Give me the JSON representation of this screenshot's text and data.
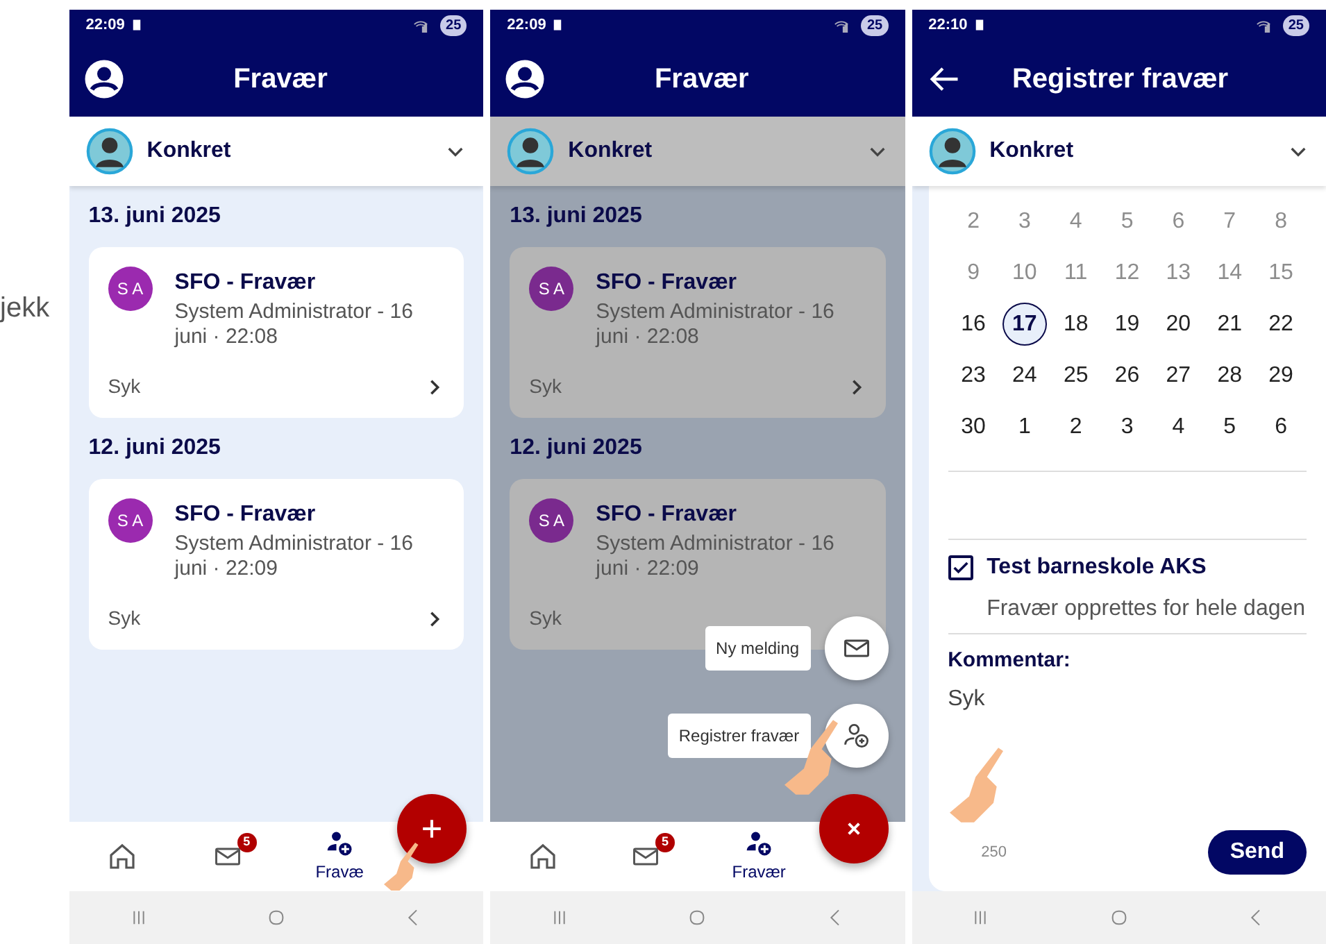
{
  "background_text": "jekk",
  "screens": [
    {
      "kind": "list",
      "dimmed": false,
      "status_bar": {
        "time": "22:09",
        "battery": "25"
      },
      "header": {
        "title": "Fravær"
      },
      "child_selector": {
        "name": "Konkret"
      },
      "days": [
        {
          "date": "13. juni 2025",
          "entries": [
            {
              "initials": "S A",
              "title": "SFO - Fravær",
              "meta": "System Administrator  - 16 juni · 22:08",
              "note": "Syk",
              "chevron_visible": true
            }
          ]
        },
        {
          "date": "12. juni 2025",
          "entries": [
            {
              "initials": "S A",
              "title": "SFO - Fravær",
              "meta": "System Administrator  - 16 juni · 22:09",
              "note": "Syk",
              "chevron_visible": true
            }
          ]
        }
      ],
      "bottom_nav": [
        {
          "selected": false
        },
        {
          "badge": "5",
          "selected": false
        },
        {
          "label": "Fravæ",
          "selected": true
        }
      ],
      "fab": {
        "kind": "add"
      }
    },
    {
      "kind": "list",
      "dimmed": true,
      "status_bar": {
        "time": "22:09",
        "battery": "25"
      },
      "header": {
        "title": "Fravær"
      },
      "child_selector": {
        "name": "Konkret"
      },
      "days": [
        {
          "date": "13. juni 2025",
          "entries": [
            {
              "initials": "S A",
              "title": "SFO - Fravær",
              "meta": "System Administrator  - 16 juni · 22:08",
              "note": "Syk",
              "chevron_visible": true
            }
          ]
        },
        {
          "date": "12. juni 2025",
          "entries": [
            {
              "initials": "S A",
              "title": "SFO - Fravær",
              "meta": "System Administrator  - 16 juni · 22:09",
              "note": "Syk",
              "chevron_visible": false
            }
          ]
        }
      ],
      "bottom_nav": [
        {
          "selected": false
        },
        {
          "badge": "5",
          "selected": false
        },
        {
          "label": "Fravær",
          "selected": true
        }
      ],
      "speed_dial": [
        {
          "label": "Ny melding"
        },
        {
          "label": "Registrer fravær"
        }
      ],
      "fab": {
        "kind": "close"
      }
    },
    {
      "kind": "form",
      "dimmed": false,
      "status_bar": {
        "time": "22:10",
        "battery": "25"
      },
      "header": {
        "title": "Registrer fravær"
      },
      "child_selector": {
        "name": "Konkret"
      },
      "calendar": [
        [
          {
            "day": "2",
            "muted": true,
            "selected": false
          },
          {
            "day": "3",
            "muted": true,
            "selected": false
          },
          {
            "day": "4",
            "muted": true,
            "selected": false
          },
          {
            "day": "5",
            "muted": true,
            "selected": false
          },
          {
            "day": "6",
            "muted": true,
            "selected": false
          },
          {
            "day": "7",
            "muted": true,
            "selected": false
          },
          {
            "day": "8",
            "muted": true,
            "selected": false
          }
        ],
        [
          {
            "day": "9",
            "muted": true,
            "selected": false
          },
          {
            "day": "10",
            "muted": true,
            "selected": false
          },
          {
            "day": "11",
            "muted": true,
            "selected": false
          },
          {
            "day": "12",
            "muted": true,
            "selected": false
          },
          {
            "day": "13",
            "muted": true,
            "selected": false
          },
          {
            "day": "14",
            "muted": true,
            "selected": false
          },
          {
            "day": "15",
            "muted": true,
            "selected": false
          }
        ],
        [
          {
            "day": "16",
            "muted": false,
            "selected": false
          },
          {
            "day": "17",
            "muted": false,
            "selected": true
          },
          {
            "day": "18",
            "muted": false,
            "selected": false
          },
          {
            "day": "19",
            "muted": false,
            "selected": false
          },
          {
            "day": "20",
            "muted": false,
            "selected": false
          },
          {
            "day": "21",
            "muted": false,
            "selected": false
          },
          {
            "day": "22",
            "muted": false,
            "selected": false
          }
        ],
        [
          {
            "day": "23",
            "muted": false,
            "selected": false
          },
          {
            "day": "24",
            "muted": false,
            "selected": false
          },
          {
            "day": "25",
            "muted": false,
            "selected": false
          },
          {
            "day": "26",
            "muted": false,
            "selected": false
          },
          {
            "day": "27",
            "muted": false,
            "selected": false
          },
          {
            "day": "28",
            "muted": false,
            "selected": false
          },
          {
            "day": "29",
            "muted": false,
            "selected": false
          }
        ],
        [
          {
            "day": "30",
            "muted": false,
            "selected": false
          },
          {
            "day": "1",
            "muted": false,
            "selected": false
          },
          {
            "day": "2",
            "muted": false,
            "selected": false
          },
          {
            "day": "3",
            "muted": false,
            "selected": false
          },
          {
            "day": "4",
            "muted": false,
            "selected": false
          },
          {
            "day": "5",
            "muted": false,
            "selected": false
          },
          {
            "day": "6",
            "muted": false,
            "selected": false
          }
        ]
      ],
      "option": {
        "label": "Test barneskole AKS",
        "checked": true,
        "note": "Fravær opprettes for hele dagen"
      },
      "comment": {
        "label": "Kommentar:",
        "value": "Syk",
        "counter": "250"
      },
      "send_button": "Send"
    }
  ]
}
